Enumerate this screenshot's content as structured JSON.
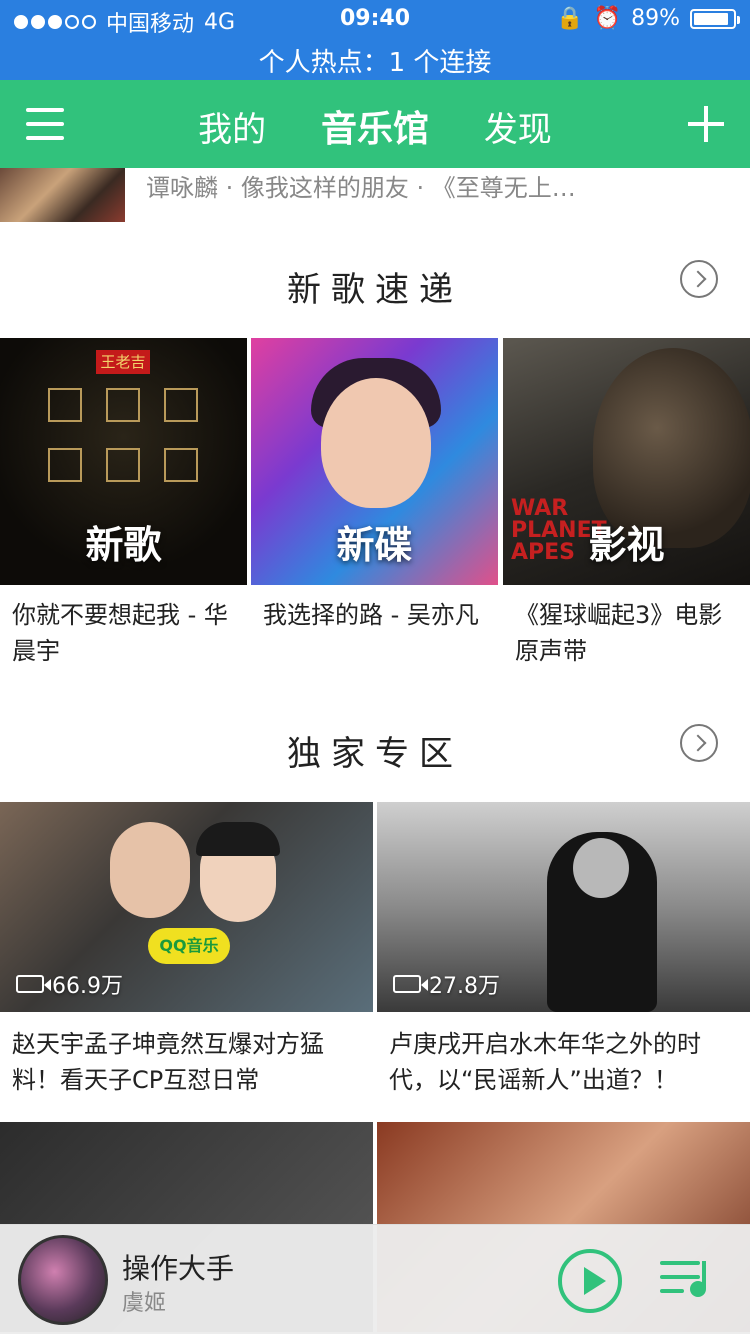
{
  "status_bar": {
    "carrier": "中国移动",
    "network": "4G",
    "time": "09:40",
    "battery_percent": "89%",
    "battery_level": 0.89,
    "hotspot": "个人热点：1 个连接",
    "signal_strength_of_5": 3
  },
  "nav": {
    "tabs": [
      "我的",
      "音乐馆",
      "发现"
    ],
    "active_tab": "音乐馆"
  },
  "partial_row": {
    "text": "谭咏麟 · 像我这样的朋友 · 《至尊无上…"
  },
  "new_songs": {
    "title": "新歌速递",
    "items": [
      {
        "cover_label": "新歌",
        "caption": "你就不要想起我 - 华晨宇"
      },
      {
        "cover_label": "新碟",
        "caption": "我选择的路 - 吴亦凡"
      },
      {
        "cover_label": "影视",
        "caption": "《猩球崛起3》电影原声带"
      }
    ]
  },
  "exclusive": {
    "title": "独家专区",
    "items": [
      {
        "views": "66.9万",
        "caption": "赵天宇孟子坤竟然互爆对方猛料！看天子CP互怼日常"
      },
      {
        "views": "27.8万",
        "caption": "卢庚戌开启水木年华之外的时代，以“民谣新人”出道？！"
      }
    ]
  },
  "mini_player": {
    "title": "操作大手",
    "artist": "虞姬"
  },
  "colors": {
    "status_bar": "#2a7fe0",
    "nav_green": "#31c27c"
  }
}
